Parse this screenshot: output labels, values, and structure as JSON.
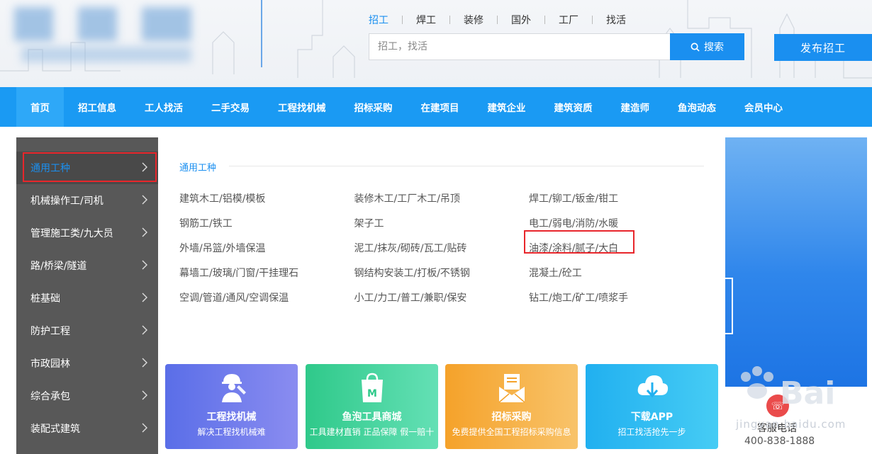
{
  "header": {
    "search_tabs": [
      "招工",
      "焊工",
      "装修",
      "国外",
      "工厂",
      "找活"
    ],
    "active_tab": 0,
    "search_placeholder": "招工，找活",
    "search_button": "搜索",
    "publish_button": "发布招工"
  },
  "nav": {
    "items": [
      "首页",
      "招工信息",
      "工人找活",
      "二手交易",
      "工程找机械",
      "招标采购",
      "在建项目",
      "建筑企业",
      "建筑资质",
      "建造师",
      "鱼泡动态",
      "会员中心"
    ],
    "active": 0
  },
  "sidebar": {
    "items": [
      {
        "label": "通用工种"
      },
      {
        "label": "机械操作工/司机"
      },
      {
        "label": "管理施工类/九大员"
      },
      {
        "label": "路/桥梁/隧道"
      },
      {
        "label": "桩基础"
      },
      {
        "label": "防护工程"
      },
      {
        "label": "市政园林"
      },
      {
        "label": "综合承包"
      },
      {
        "label": "装配式建筑"
      }
    ],
    "active": 0
  },
  "panel": {
    "title": "通用工种",
    "rows": [
      [
        "建筑木工/铝模/模板",
        "装修木工/工厂木工/吊顶",
        "焊工/铆工/钣金/钳工"
      ],
      [
        "钢筋工/铁工",
        "架子工",
        "电工/弱电/消防/水暖"
      ],
      [
        "外墙/吊篮/外墙保温",
        "泥工/抹灰/砌砖/瓦工/贴砖",
        "油漆/涂料/腻子/大白"
      ],
      [
        "幕墙工/玻璃/门窗/干挂理石",
        "钢结构安装工/打板/不锈钢",
        "混凝土/砼工"
      ],
      [
        "空调/管道/通风/空调保温",
        "小工/力工/普工/兼职/保安",
        "钻工/炮工/矿工/喷浆手"
      ]
    ]
  },
  "cards": [
    {
      "title": "工程找机械",
      "sub": "解决工程找机械难",
      "icon": "worker-wrench-icon"
    },
    {
      "title": "鱼泡工具商城",
      "sub": "工具建材直销 正品保障 假一赔十",
      "icon": "shopping-bag-icon"
    },
    {
      "title": "招标采购",
      "sub": "免费提供全国工程招标采购信息",
      "icon": "envelope-document-icon"
    },
    {
      "title": "下载APP",
      "sub": "招工找活抢先一步",
      "icon": "cloud-download-icon"
    }
  ],
  "service": {
    "label": "客服电话",
    "phone": "400-838-1888"
  },
  "watermark": {
    "text": "jingyan.baidu.com"
  },
  "colors": {
    "accent": "#1a8ff0",
    "nav_bg": "#1a9af3",
    "sidebar_bg": "#585858",
    "highlight": "#e8262b"
  }
}
